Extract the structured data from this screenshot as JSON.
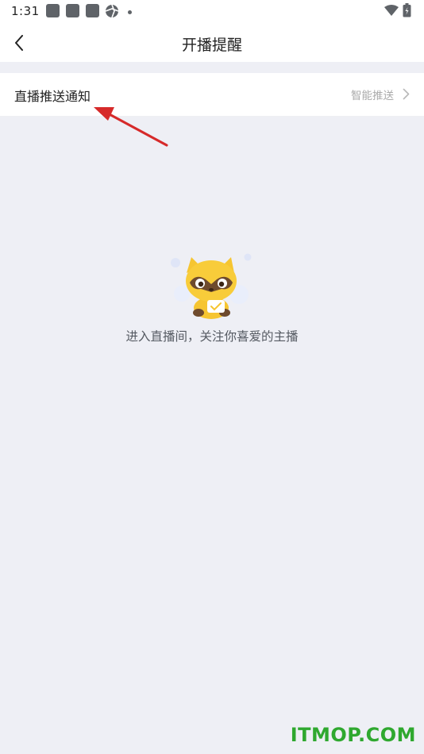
{
  "status_bar": {
    "time": "1:31"
  },
  "header": {
    "title": "开播提醒"
  },
  "setting": {
    "label": "直播推送通知",
    "value": "智能推送"
  },
  "empty_state": {
    "message": "进入直播间，关注你喜爱的主播"
  },
  "watermark": {
    "text": "ITMOP.COM"
  },
  "colors": {
    "background": "#eeeff5",
    "surface": "#ffffff",
    "annotation_arrow": "#d62a2a",
    "watermark": "#2fa82f",
    "mascot_yellow": "#f6c531"
  }
}
